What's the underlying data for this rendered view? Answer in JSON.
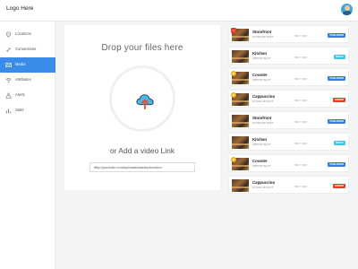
{
  "header": {
    "logo": "Logo Here"
  },
  "sidebar": {
    "items": [
      {
        "label": "Locations",
        "icon": "location-pin-icon"
      },
      {
        "label": "Connections",
        "icon": "link-icon"
      },
      {
        "label": "Media",
        "icon": "media-icon",
        "active": true
      },
      {
        "label": "Attributes",
        "icon": "wifi-icon"
      },
      {
        "label": "Alerts",
        "icon": "alert-icon"
      },
      {
        "label": "Stats",
        "icon": "stats-icon"
      }
    ]
  },
  "upload": {
    "drop_title": "Drop your files here",
    "or_text": "or Add a video Link",
    "link_value": "http://youtube.com/uploads/starbucksvideo"
  },
  "media_list": [
    {
      "title": "Storefront",
      "subtitle": "OUTDOOR SHOT",
      "dims": "800 X 600",
      "status": "PUBLISHED",
      "flag": "x"
    },
    {
      "title": "Kitchen",
      "subtitle": "INDOOR SHOT",
      "dims": "800 X 600",
      "status": "DRAFT",
      "flag": ""
    },
    {
      "title": "Counter",
      "subtitle": "INDOOR SHOT",
      "dims": "800 X 600",
      "status": "PUBLISHED",
      "flag": "star"
    },
    {
      "title": "Cappuccino",
      "subtitle": "CLOSE UP SHOT",
      "dims": "800 X 600",
      "status": "ERROR",
      "flag": "star"
    },
    {
      "title": "Storefront",
      "subtitle": "OUTDOOR SHOT",
      "dims": "800 X 600",
      "status": "PUBLISHED",
      "flag": ""
    },
    {
      "title": "Kitchen",
      "subtitle": "INDOOR SHOT",
      "dims": "800 X 600",
      "status": "DRAFT",
      "flag": ""
    },
    {
      "title": "Counter",
      "subtitle": "INDOOR SHOT",
      "dims": "800 X 600",
      "status": "PUBLISHED",
      "flag": "star"
    },
    {
      "title": "Cappuccino",
      "subtitle": "CLOSE UP SHOT",
      "dims": "800 X 600",
      "status": "ERROR",
      "flag": ""
    }
  ],
  "status_colors": {
    "PUBLISHED": "#3b7be0",
    "DRAFT": "#3cc3e8",
    "ERROR": "#e2412c"
  },
  "colors": {
    "accent": "#3b8be8"
  }
}
